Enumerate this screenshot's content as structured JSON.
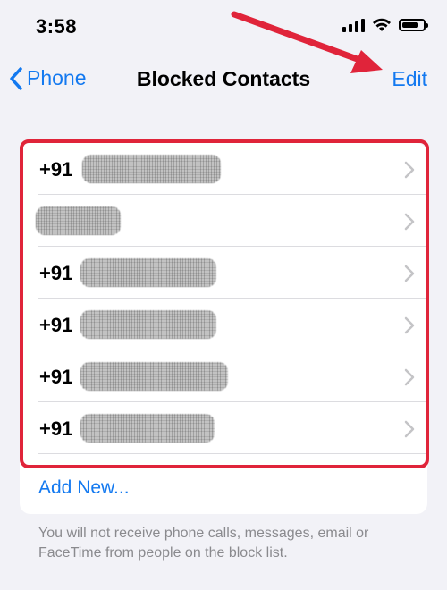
{
  "status_bar": {
    "time": "3:58"
  },
  "nav": {
    "back_label": "Phone",
    "title": "Blocked Contacts",
    "edit_label": "Edit"
  },
  "contacts": [
    {
      "prefix": "+91"
    },
    {
      "prefix": ""
    },
    {
      "prefix": "+91"
    },
    {
      "prefix": "+91"
    },
    {
      "prefix": "+91"
    },
    {
      "prefix": "+91"
    }
  ],
  "add_new_label": "Add New...",
  "footer_note": "You will not receive phone calls, messages, email or FaceTime from people on the block list.",
  "colors": {
    "accent": "#1379f0",
    "highlight": "#e0243a",
    "background": "#f2f2f7"
  },
  "icons": [
    "signal-icon",
    "wifi-icon",
    "battery-icon",
    "chevron-left-icon",
    "chevron-right-icon",
    "red-arrow"
  ]
}
